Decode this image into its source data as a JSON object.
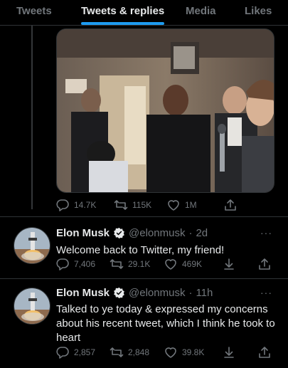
{
  "tabs": [
    {
      "label": "Tweets",
      "active": false
    },
    {
      "label": "Tweets & replies",
      "active": true
    },
    {
      "label": "Media",
      "active": false
    },
    {
      "label": "Likes",
      "active": false
    }
  ],
  "colors": {
    "accent": "#1d9bf0",
    "background": "#000000",
    "muted": "#71767b",
    "text": "#e7e9ea",
    "verified": "#e7e9ea"
  },
  "media_post": {
    "replies": "14.7K",
    "retweets": "115K",
    "likes": "1M"
  },
  "tweets": [
    {
      "name": "Elon Musk",
      "handle": "@elonmusk",
      "sep": "·",
      "time": "2d",
      "text": "Welcome back to Twitter, my friend!",
      "replies": "7,406",
      "retweets": "29.1K",
      "likes": "469K",
      "more": "···"
    },
    {
      "name": "Elon Musk",
      "handle": "@elonmusk",
      "sep": "·",
      "time": "11h",
      "text": "Talked to ye today & expressed my concerns about his recent tweet, which I think he took to heart",
      "replies": "2,857",
      "retweets": "2,848",
      "likes": "39.8K",
      "more": "···"
    }
  ],
  "icons": [
    "reply-icon",
    "retweet-icon",
    "like-icon",
    "share-icon",
    "download-icon",
    "verified-badge-icon",
    "more-icon"
  ]
}
